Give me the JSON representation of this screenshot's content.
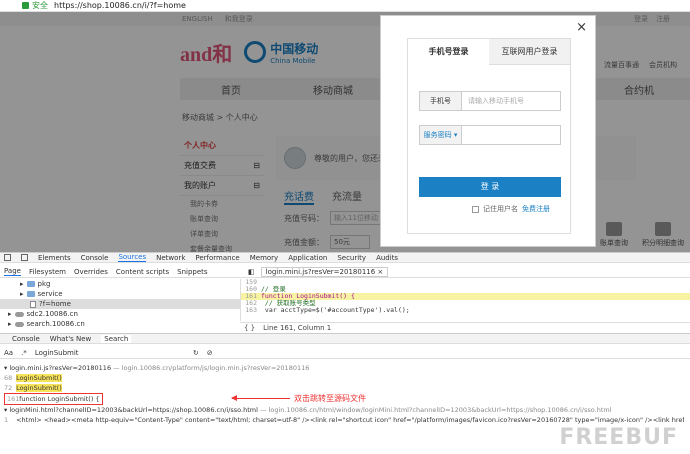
{
  "browser": {
    "secure_label": "安全",
    "url": "https://shop.10086.cn/i/?f=home"
  },
  "site": {
    "top_links": [
      "ENGLISH",
      "和我登录"
    ],
    "top_right": [
      "登录",
      "注册"
    ],
    "logo_andhe": "and和",
    "logo_cm_cn": "中国移动",
    "logo_cm_en": "China Mobile",
    "right_links": [
      "流量百事通",
      "会员机构",
      "移动"
    ],
    "nav": [
      "首页",
      "移动商城",
      "",
      "",
      "",
      "合约机"
    ],
    "breadcrumb": "移动商城 > 个人中心",
    "sidebar": {
      "personal": "个人中心",
      "recharge": "充值交费",
      "account": "我的账户",
      "subs": [
        "我的卡券",
        "账单查询",
        "详单查询",
        "套餐余量查询"
      ]
    },
    "welcome": "尊敬的用户，您还未",
    "tabs": [
      "充话费",
      "充流量"
    ],
    "phone_label": "充值号码：",
    "phone_placeholder": "输入11位移动",
    "amount_label": "充值金额：",
    "amount_value": "50元",
    "quick": [
      "账单查询",
      "积分明细查询"
    ]
  },
  "modal": {
    "close": "×",
    "tab_phone": "手机号登录",
    "tab_internet": "互联网用户登录",
    "phone_label": "手机号",
    "phone_placeholder": "请输入移动手机号",
    "pwd_label": "服务密码",
    "login_btn": "登 录",
    "remember": "记住用户名",
    "register": "免费注册"
  },
  "devtools": {
    "tabs": [
      "Elements",
      "Console",
      "Sources",
      "Network",
      "Performance",
      "Memory",
      "Application",
      "Security",
      "Audits"
    ],
    "src_sub": [
      "Page",
      "Filesystem",
      "Overrides",
      "Content scripts",
      "Snippets"
    ],
    "tree": [
      "pkg",
      "service",
      "?f=home",
      "sdc2.10086.cn",
      "search.10086.cn"
    ],
    "editor_file": "login.mini.js?resVer=20180116",
    "code_lines": [
      {
        "n": "159",
        "t": ""
      },
      {
        "n": "160",
        "t": "// 登录"
      },
      {
        "n": "161",
        "t": "function LoginSubmit() {"
      },
      {
        "n": "162",
        "t": "    // 获取账号类型"
      },
      {
        "n": "163",
        "t": "    var acctType=$('#accountType').val();"
      }
    ],
    "editor_status": "Line 161, Column 1",
    "drawer_tabs": [
      "Console",
      "What's New",
      "Search"
    ],
    "search_query": "LoginSubmit",
    "result1_file": "login.mini.js?resVer=20180116",
    "result1_path": "— login.10086.cn/platform/js/login.min.js?resVer=20180116",
    "r_lines": [
      {
        "n": "68",
        "t": "LoginSubmit()"
      },
      {
        "n": "72",
        "t": "LoginSubmit()"
      },
      {
        "n": "161",
        "t": "function LoginSubmit() {"
      }
    ],
    "result2_file": "loginMini.html?channelID=12003&backUrl=https://shop.10086.cn/i/sso.html",
    "result2_path": "— login.10086.cn/html/window/loginMini.html?channelID=12003&backUrl=https://shop.10086.cn/i/sso.html",
    "result2_line": "<html> <head><meta http-equiv=\"Content-Type\" content=\"text/html; charset=utf-8\" /><link rel=\"shortcut icon\" href=\"/platform/images/favicon.ico?resVer=20160728\" type=\"image/x-icon\" /><link href=\"/platform/css/ngcaMini.css?resVer=20",
    "annotation": "双击跳转至源码文件"
  },
  "watermark": "FREEBUF",
  "colors": {
    "accent": "#1b80c4",
    "annotation": "#e33333",
    "brand_pink": "#e0557a"
  }
}
